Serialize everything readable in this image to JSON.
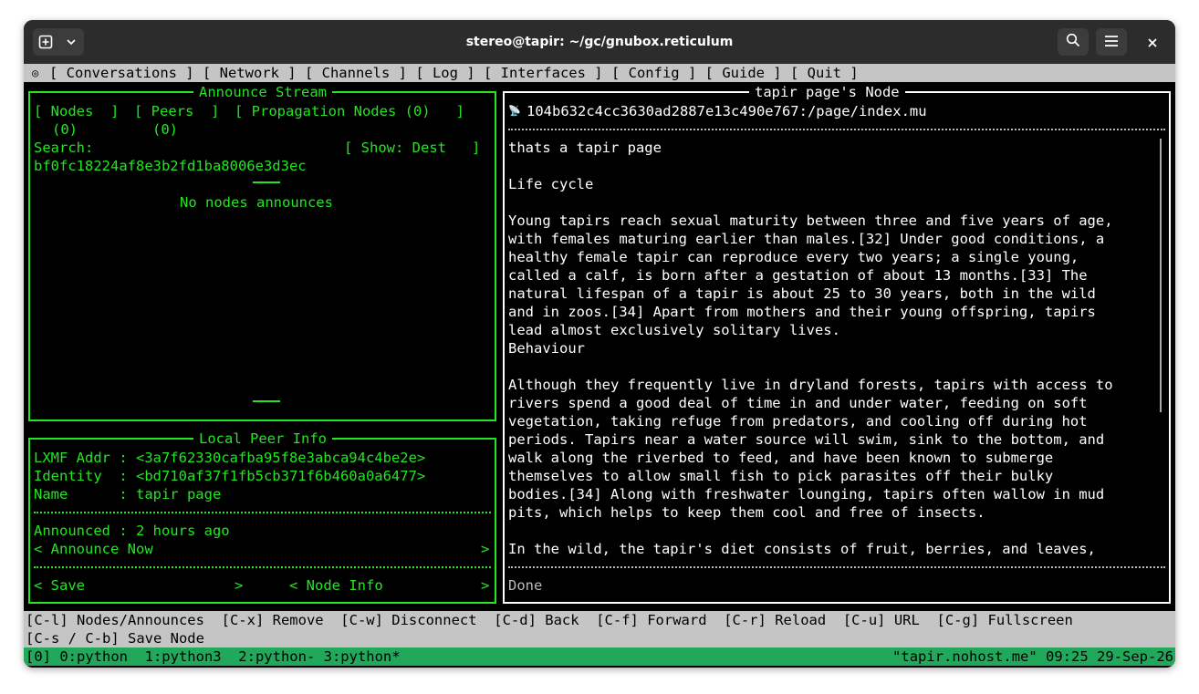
{
  "window": {
    "title": "stereo@tapir: ~/gc/gnubox.reticulum"
  },
  "menu": {
    "items": [
      "[ Conversations ]",
      "[ Network ]",
      "[ Channels ]",
      "[ Log ]",
      "[ Interfaces ]",
      "[ Config ]",
      "[ Guide ]",
      "[ Quit ]"
    ]
  },
  "announce": {
    "title": "Announce Stream",
    "tabs": [
      "[ Nodes  ]",
      "[ Peers  ]",
      "[ Propagation Nodes (0)   ]"
    ],
    "tab_counts": [
      "(0)",
      "(0)"
    ],
    "search_label": "Search:",
    "search_value": "bf0fc18224af8e3b2fd1ba8006e3d3ec",
    "show_button": "[ Show: Dest   ]",
    "empty": "No nodes announces"
  },
  "peer": {
    "title": "Local Peer Info",
    "lxmf": "LXMF Addr : <3a7f62330cafba95f8e3abca94c4be2e>",
    "identity": "Identity  : <bd710af37f1fb5cb371f6b460a0a6477>",
    "name": "Name      : tapir page",
    "announced": "Announced : 2 hours ago",
    "announce_now": "< Announce Now",
    "announce_now_arrow": ">",
    "save": "< Save",
    "save_arrow": ">",
    "node_info": "< Node Info",
    "node_info_arrow": ">"
  },
  "browser": {
    "title": "tapir page's Node",
    "address": "104b632c4cc3630ad2887e13c490e767:/page/index.mu",
    "lines": [
      "thats a tapir page",
      "",
      "Life cycle",
      "",
      "Young tapirs reach sexual maturity between three and five years of age,",
      "with females maturing earlier than males.[32] Under good conditions, a",
      "healthy female tapir can reproduce every two years; a single young,",
      "called a calf, is born after a gestation of about 13 months.[33] The",
      "natural lifespan of a tapir is about 25 to 30 years, both in the wild",
      "and in zoos.[34] Apart from mothers and their young offspring, tapirs",
      "lead almost exclusively solitary lives.",
      "Behaviour",
      "",
      "Although they frequently live in dryland forests, tapirs with access to",
      "rivers spend a good deal of time in and under water, feeding on soft",
      "vegetation, taking refuge from predators, and cooling off during hot",
      "periods. Tapirs near a water source will swim, sink to the bottom, and",
      "walk along the riverbed to feed, and have been known to submerge",
      "themselves to allow small fish to pick parasites off their bulky",
      "bodies.[34] Along with freshwater lounging, tapirs often wallow in mud",
      "pits, which helps to keep them cool and free of insects.",
      "",
      "In the wild, the tapir's diet consists of fruit, berries, and leaves,"
    ],
    "status": "Done"
  },
  "keys": {
    "line1": "[C-l] Nodes/Announces  [C-x] Remove  [C-w] Disconnect  [C-d] Back  [C-f] Forward  [C-r] Reload  [C-u] URL  [C-g] Fullscreen",
    "line2": "[C-s / C-b] Save Node"
  },
  "tmux": {
    "windows": "[0] 0:python  1:python3  2:python- 3:python*",
    "status": "\"tapir.nohost.me\" 09:25 29-Sep-26"
  },
  "colors": {
    "green": "#22e622",
    "tmux_green": "#22a85a",
    "bar_gray": "#c5c5c5"
  }
}
